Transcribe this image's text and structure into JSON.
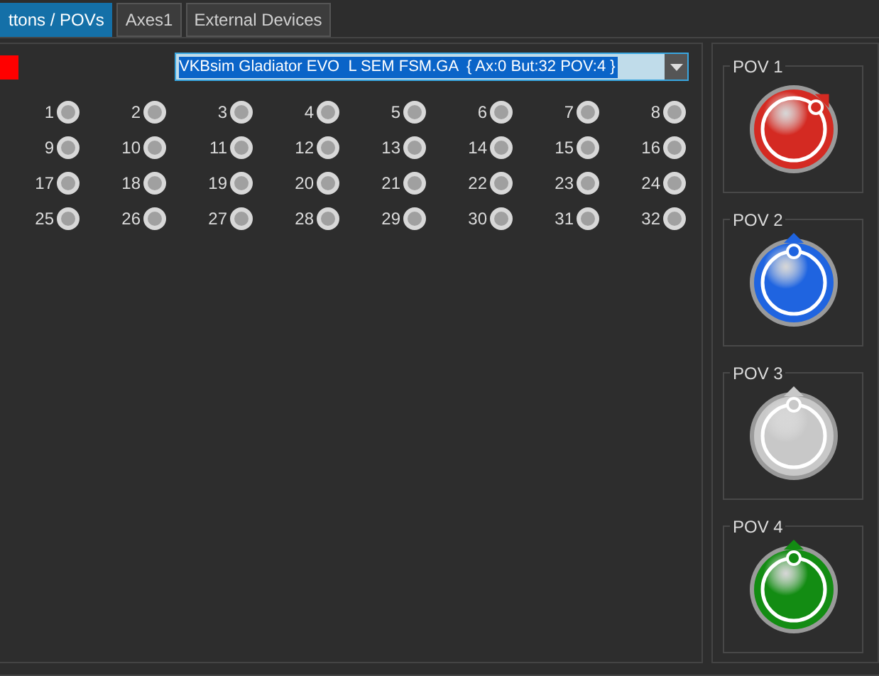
{
  "tabs": [
    {
      "label": "ttons / POVs",
      "selected": true
    },
    {
      "label": "Axes1",
      "selected": false
    },
    {
      "label": "External Devices",
      "selected": false
    }
  ],
  "indicator": {
    "color": "#ff0000"
  },
  "device_select": {
    "value": "VKBsim Gladiator EVO  L SEM FSM.GA  { Ax:0 But:32 POV:4 }"
  },
  "buttons": [
    {
      "label": "1",
      "pressed": false
    },
    {
      "label": "2",
      "pressed": false
    },
    {
      "label": "3",
      "pressed": false
    },
    {
      "label": "4",
      "pressed": false
    },
    {
      "label": "5",
      "pressed": false
    },
    {
      "label": "6",
      "pressed": false
    },
    {
      "label": "7",
      "pressed": false
    },
    {
      "label": "8",
      "pressed": false
    },
    {
      "label": "9",
      "pressed": false
    },
    {
      "label": "10",
      "pressed": false
    },
    {
      "label": "11",
      "pressed": false
    },
    {
      "label": "12",
      "pressed": false
    },
    {
      "label": "13",
      "pressed": false
    },
    {
      "label": "14",
      "pressed": false
    },
    {
      "label": "15",
      "pressed": false
    },
    {
      "label": "16",
      "pressed": false
    },
    {
      "label": "17",
      "pressed": false
    },
    {
      "label": "18",
      "pressed": false
    },
    {
      "label": "19",
      "pressed": false
    },
    {
      "label": "20",
      "pressed": false
    },
    {
      "label": "21",
      "pressed": false
    },
    {
      "label": "22",
      "pressed": false
    },
    {
      "label": "23",
      "pressed": false
    },
    {
      "label": "24",
      "pressed": false
    },
    {
      "label": "25",
      "pressed": false
    },
    {
      "label": "26",
      "pressed": false
    },
    {
      "label": "27",
      "pressed": false
    },
    {
      "label": "28",
      "pressed": false
    },
    {
      "label": "29",
      "pressed": false
    },
    {
      "label": "30",
      "pressed": false
    },
    {
      "label": "31",
      "pressed": false
    },
    {
      "label": "32",
      "pressed": false
    }
  ],
  "povs": [
    {
      "title": "POV 1",
      "color": "#d42a22",
      "deflected": true
    },
    {
      "title": "POV 2",
      "color": "#1f64e0",
      "deflected": false
    },
    {
      "title": "POV 3",
      "color": "#c8c8c8",
      "deflected": false
    },
    {
      "title": "POV 4",
      "color": "#138c13",
      "deflected": false
    }
  ]
}
